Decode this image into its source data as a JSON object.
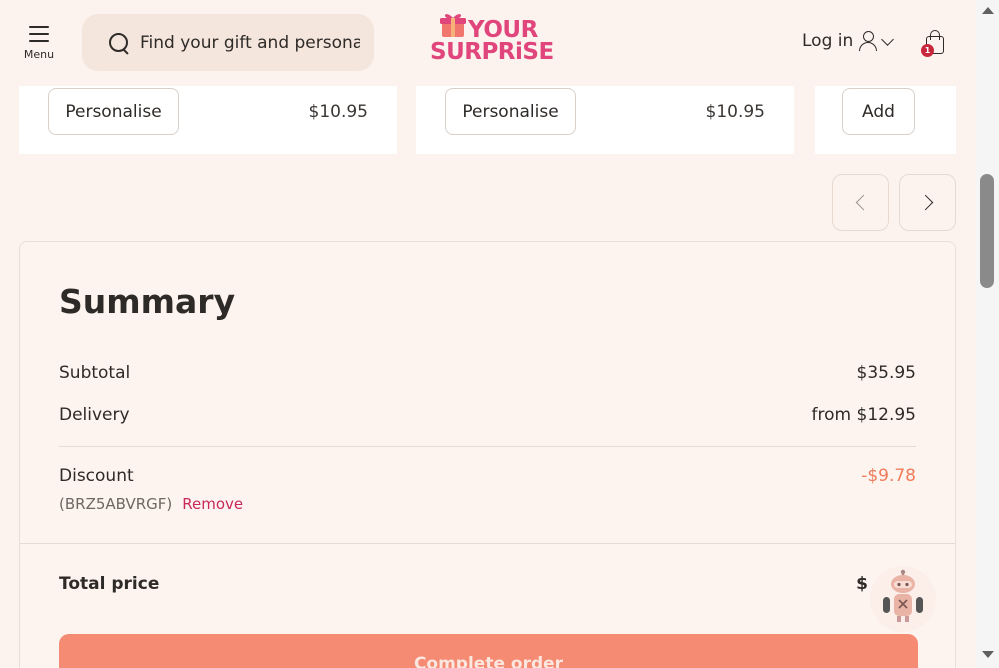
{
  "header": {
    "menu_label": "Menu",
    "search_placeholder": "Find your gift and personali",
    "logo_line1": "YOUR",
    "logo_line2": "SURPRiSE",
    "login_label": "Log in",
    "cart_count": "1"
  },
  "products": [
    {
      "button_label": "Personalise",
      "price": "$10.95"
    },
    {
      "button_label": "Personalise",
      "price": "$10.95"
    },
    {
      "button_label": "Add"
    }
  ],
  "summary": {
    "title": "Summary",
    "subtotal_label": "Subtotal",
    "subtotal_value": "$35.95",
    "delivery_label": "Delivery",
    "delivery_value": "from $12.95",
    "discount_label": "Discount",
    "discount_value": "-$9.78",
    "discount_code": "(BRZ5ABVRGF)",
    "remove_label": "Remove",
    "total_label": "Total price",
    "total_value": "$",
    "complete_label": "Complete order"
  },
  "colors": {
    "background": "#fdf3ee",
    "brand_pink": "#e0457b",
    "cta": "#f48b72",
    "discount": "#f07c5a",
    "badge": "#c8283c"
  },
  "icons": [
    "menu-icon",
    "search-icon",
    "gift-icon",
    "user-icon",
    "chevron-down-icon",
    "shopping-bag-icon",
    "chevron-left-icon",
    "chevron-right-icon",
    "chatbot-robot-icon"
  ]
}
